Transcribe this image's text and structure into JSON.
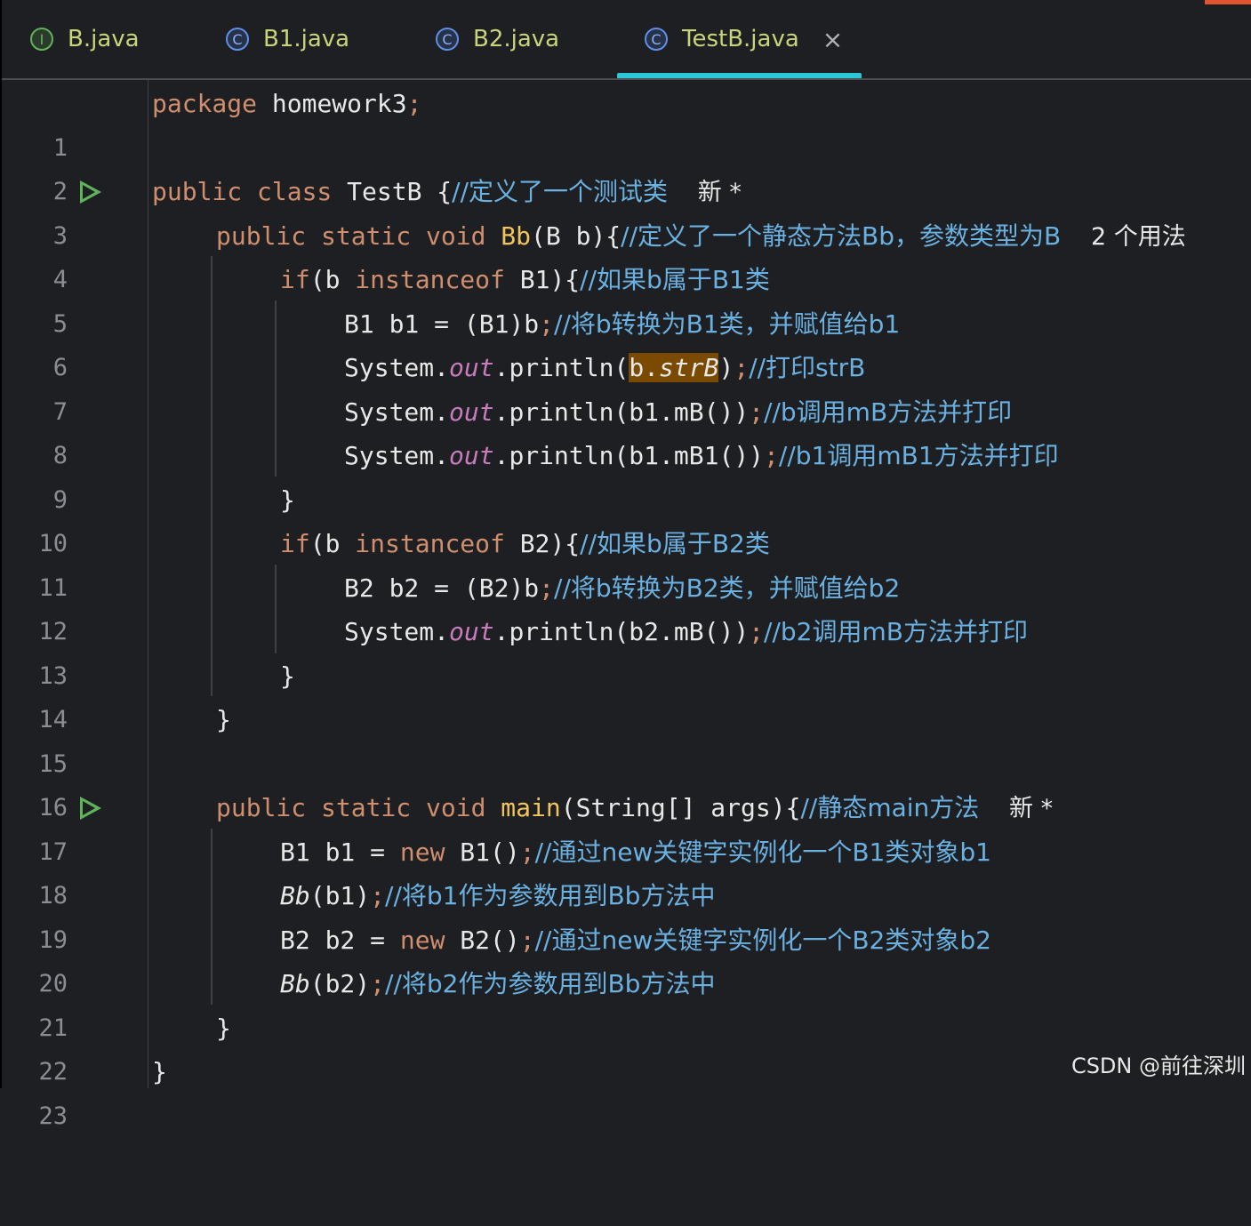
{
  "tabs": [
    {
      "icon": "I",
      "label": "B.java"
    },
    {
      "icon": "C",
      "label": "B1.java"
    },
    {
      "icon": "C",
      "label": "B2.java"
    },
    {
      "icon": "C",
      "label": "TestB.java",
      "close": "×"
    }
  ],
  "editor": {
    "line_numbers": [
      "1",
      "2",
      "3",
      "4",
      "5",
      "6",
      "7",
      "8",
      "9",
      "10",
      "11",
      "12",
      "13",
      "14",
      "15",
      "16",
      "17",
      "18",
      "19",
      "20",
      "21",
      "22",
      "23"
    ],
    "l1": {
      "kw": "package",
      "name": " homework3",
      "semi": ";"
    },
    "l3": {
      "kw": "public class",
      "name": " TestB {",
      "comment": "//定义了一个测试类",
      "hint": "新 *"
    },
    "l4": {
      "kw": "public static void",
      "fn": " Bb",
      "params": "(B b){",
      "comment": "//定义了一个静态方法Bb，参数类型为B",
      "hint": "2 个用法"
    },
    "l5": {
      "kw1": "if",
      "a": "(b ",
      "kw2": "instanceof",
      "b": " B1){",
      "comment": "//如果b属于B1类"
    },
    "l6": {
      "code": "B1 b1 = (B1)b",
      "semi": ";",
      "comment": "//将b转换为B1类，并赋值给b1"
    },
    "l7": {
      "pre": "System.",
      "out": "out",
      "mid": ".println(",
      "hl_a": "b.",
      "hl_b": "strB",
      "post": ")",
      "semi": ";",
      "comment": "//打印strB"
    },
    "l8": {
      "pre": "System.",
      "out": "out",
      "mid": ".println(b1.mB())",
      "semi": ";",
      "comment": "//b调用mB方法并打印"
    },
    "l9": {
      "pre": "System.",
      "out": "out",
      "mid": ".println(b1.mB1())",
      "semi": ";",
      "comment": "//b1调用mB1方法并打印"
    },
    "l10": "}",
    "l11": {
      "kw1": "if",
      "a": "(b ",
      "kw2": "instanceof",
      "b": " B2){",
      "comment": "//如果b属于B2类"
    },
    "l12": {
      "code": "B2 b2 = (B2)b",
      "semi": ";",
      "comment": "//将b转换为B2类，并赋值给b2"
    },
    "l13": {
      "pre": "System.",
      "out": "out",
      "mid": ".println(b2.mB())",
      "semi": ";",
      "comment": "//b2调用mB方法并打印"
    },
    "l14": "}",
    "l15": "}",
    "l17": {
      "kw": "public static void",
      "fn": " main",
      "params": "(String[] args){",
      "comment": "//静态main方法",
      "hint": "新 *"
    },
    "l18": {
      "a": "B1 b1 = ",
      "kw": "new",
      "b": " B1()",
      "semi": ";",
      "comment": "//通过new关键字实例化一个B1类对象b1"
    },
    "l19": {
      "fn": "Bb",
      "b": "(b1)",
      "semi": ";",
      "comment": "//将b1作为参数用到Bb方法中"
    },
    "l20": {
      "a": "B2 b2 = ",
      "kw": "new",
      "b": " B2()",
      "semi": ";",
      "comment": "//通过new关键字实例化一个B2类对象b2"
    },
    "l21": {
      "fn": "Bb",
      "b": "(b2)",
      "semi": ";",
      "comment": "//将b2作为参数用到Bb方法中"
    },
    "l22": "}",
    "l23": "}"
  },
  "watermark": "CSDN @前往深圳"
}
